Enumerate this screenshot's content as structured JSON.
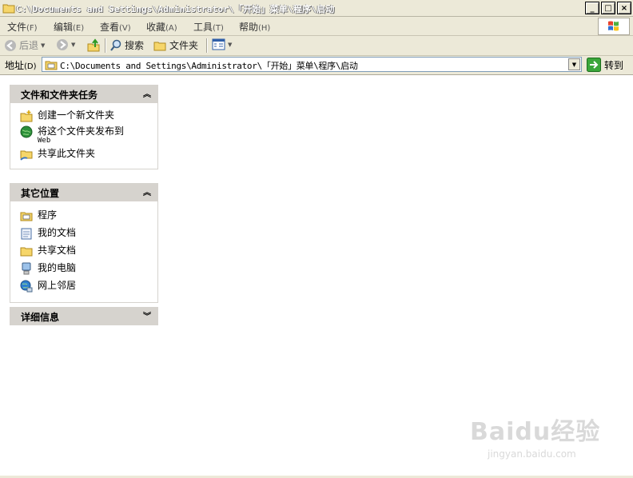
{
  "window": {
    "title": "C:\\Documents and Settings\\Administrator\\「开始」菜单\\程序\\启动",
    "minimize": "_",
    "maximize": "□",
    "close": "×"
  },
  "menu": [
    {
      "label": "文件",
      "acc": "(F)"
    },
    {
      "label": "编辑",
      "acc": "(E)"
    },
    {
      "label": "查看",
      "acc": "(V)"
    },
    {
      "label": "收藏",
      "acc": "(A)"
    },
    {
      "label": "工具",
      "acc": "(T)"
    },
    {
      "label": "帮助",
      "acc": "(H)"
    }
  ],
  "toolbar": {
    "back": "后退",
    "search": "搜索",
    "folders": "文件夹"
  },
  "address": {
    "label": "地址",
    "acc": "(D)",
    "path": "C:\\Documents and Settings\\Administrator\\「开始」菜单\\程序\\启动",
    "go": "转到"
  },
  "panels": {
    "tasks": {
      "title": "文件和文件夹任务",
      "items": [
        {
          "label": "创建一个新文件夹"
        },
        {
          "label": "将这个文件夹发布到",
          "sub": "Web"
        },
        {
          "label": "共享此文件夹"
        }
      ]
    },
    "places": {
      "title": "其它位置",
      "items": [
        {
          "label": "程序"
        },
        {
          "label": "我的文档"
        },
        {
          "label": "共享文档"
        },
        {
          "label": "我的电脑"
        },
        {
          "label": "网上邻居"
        }
      ]
    },
    "details": {
      "title": "详细信息"
    }
  },
  "watermark": {
    "brand": "Baidu经验",
    "site": "jingyan.baidu.com"
  }
}
